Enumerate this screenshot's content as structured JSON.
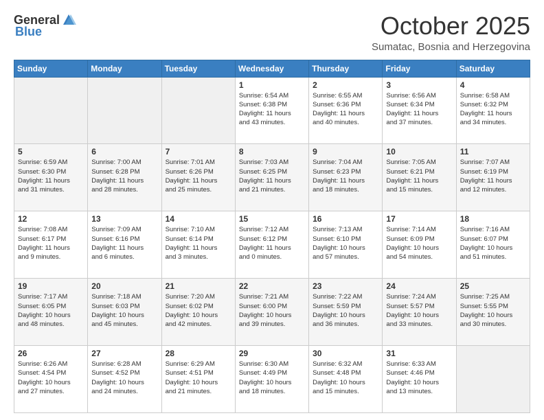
{
  "header": {
    "logo_general": "General",
    "logo_blue": "Blue",
    "month_title": "October 2025",
    "location": "Sumatac, Bosnia and Herzegovina"
  },
  "days_of_week": [
    "Sunday",
    "Monday",
    "Tuesday",
    "Wednesday",
    "Thursday",
    "Friday",
    "Saturday"
  ],
  "weeks": [
    [
      {
        "day": "",
        "info": ""
      },
      {
        "day": "",
        "info": ""
      },
      {
        "day": "",
        "info": ""
      },
      {
        "day": "1",
        "info": "Sunrise: 6:54 AM\nSunset: 6:38 PM\nDaylight: 11 hours\nand 43 minutes."
      },
      {
        "day": "2",
        "info": "Sunrise: 6:55 AM\nSunset: 6:36 PM\nDaylight: 11 hours\nand 40 minutes."
      },
      {
        "day": "3",
        "info": "Sunrise: 6:56 AM\nSunset: 6:34 PM\nDaylight: 11 hours\nand 37 minutes."
      },
      {
        "day": "4",
        "info": "Sunrise: 6:58 AM\nSunset: 6:32 PM\nDaylight: 11 hours\nand 34 minutes."
      }
    ],
    [
      {
        "day": "5",
        "info": "Sunrise: 6:59 AM\nSunset: 6:30 PM\nDaylight: 11 hours\nand 31 minutes."
      },
      {
        "day": "6",
        "info": "Sunrise: 7:00 AM\nSunset: 6:28 PM\nDaylight: 11 hours\nand 28 minutes."
      },
      {
        "day": "7",
        "info": "Sunrise: 7:01 AM\nSunset: 6:26 PM\nDaylight: 11 hours\nand 25 minutes."
      },
      {
        "day": "8",
        "info": "Sunrise: 7:03 AM\nSunset: 6:25 PM\nDaylight: 11 hours\nand 21 minutes."
      },
      {
        "day": "9",
        "info": "Sunrise: 7:04 AM\nSunset: 6:23 PM\nDaylight: 11 hours\nand 18 minutes."
      },
      {
        "day": "10",
        "info": "Sunrise: 7:05 AM\nSunset: 6:21 PM\nDaylight: 11 hours\nand 15 minutes."
      },
      {
        "day": "11",
        "info": "Sunrise: 7:07 AM\nSunset: 6:19 PM\nDaylight: 11 hours\nand 12 minutes."
      }
    ],
    [
      {
        "day": "12",
        "info": "Sunrise: 7:08 AM\nSunset: 6:17 PM\nDaylight: 11 hours\nand 9 minutes."
      },
      {
        "day": "13",
        "info": "Sunrise: 7:09 AM\nSunset: 6:16 PM\nDaylight: 11 hours\nand 6 minutes."
      },
      {
        "day": "14",
        "info": "Sunrise: 7:10 AM\nSunset: 6:14 PM\nDaylight: 11 hours\nand 3 minutes."
      },
      {
        "day": "15",
        "info": "Sunrise: 7:12 AM\nSunset: 6:12 PM\nDaylight: 11 hours\nand 0 minutes."
      },
      {
        "day": "16",
        "info": "Sunrise: 7:13 AM\nSunset: 6:10 PM\nDaylight: 10 hours\nand 57 minutes."
      },
      {
        "day": "17",
        "info": "Sunrise: 7:14 AM\nSunset: 6:09 PM\nDaylight: 10 hours\nand 54 minutes."
      },
      {
        "day": "18",
        "info": "Sunrise: 7:16 AM\nSunset: 6:07 PM\nDaylight: 10 hours\nand 51 minutes."
      }
    ],
    [
      {
        "day": "19",
        "info": "Sunrise: 7:17 AM\nSunset: 6:05 PM\nDaylight: 10 hours\nand 48 minutes."
      },
      {
        "day": "20",
        "info": "Sunrise: 7:18 AM\nSunset: 6:03 PM\nDaylight: 10 hours\nand 45 minutes."
      },
      {
        "day": "21",
        "info": "Sunrise: 7:20 AM\nSunset: 6:02 PM\nDaylight: 10 hours\nand 42 minutes."
      },
      {
        "day": "22",
        "info": "Sunrise: 7:21 AM\nSunset: 6:00 PM\nDaylight: 10 hours\nand 39 minutes."
      },
      {
        "day": "23",
        "info": "Sunrise: 7:22 AM\nSunset: 5:59 PM\nDaylight: 10 hours\nand 36 minutes."
      },
      {
        "day": "24",
        "info": "Sunrise: 7:24 AM\nSunset: 5:57 PM\nDaylight: 10 hours\nand 33 minutes."
      },
      {
        "day": "25",
        "info": "Sunrise: 7:25 AM\nSunset: 5:55 PM\nDaylight: 10 hours\nand 30 minutes."
      }
    ],
    [
      {
        "day": "26",
        "info": "Sunrise: 6:26 AM\nSunset: 4:54 PM\nDaylight: 10 hours\nand 27 minutes."
      },
      {
        "day": "27",
        "info": "Sunrise: 6:28 AM\nSunset: 4:52 PM\nDaylight: 10 hours\nand 24 minutes."
      },
      {
        "day": "28",
        "info": "Sunrise: 6:29 AM\nSunset: 4:51 PM\nDaylight: 10 hours\nand 21 minutes."
      },
      {
        "day": "29",
        "info": "Sunrise: 6:30 AM\nSunset: 4:49 PM\nDaylight: 10 hours\nand 18 minutes."
      },
      {
        "day": "30",
        "info": "Sunrise: 6:32 AM\nSunset: 4:48 PM\nDaylight: 10 hours\nand 15 minutes."
      },
      {
        "day": "31",
        "info": "Sunrise: 6:33 AM\nSunset: 4:46 PM\nDaylight: 10 hours\nand 13 minutes."
      },
      {
        "day": "",
        "info": ""
      }
    ]
  ]
}
